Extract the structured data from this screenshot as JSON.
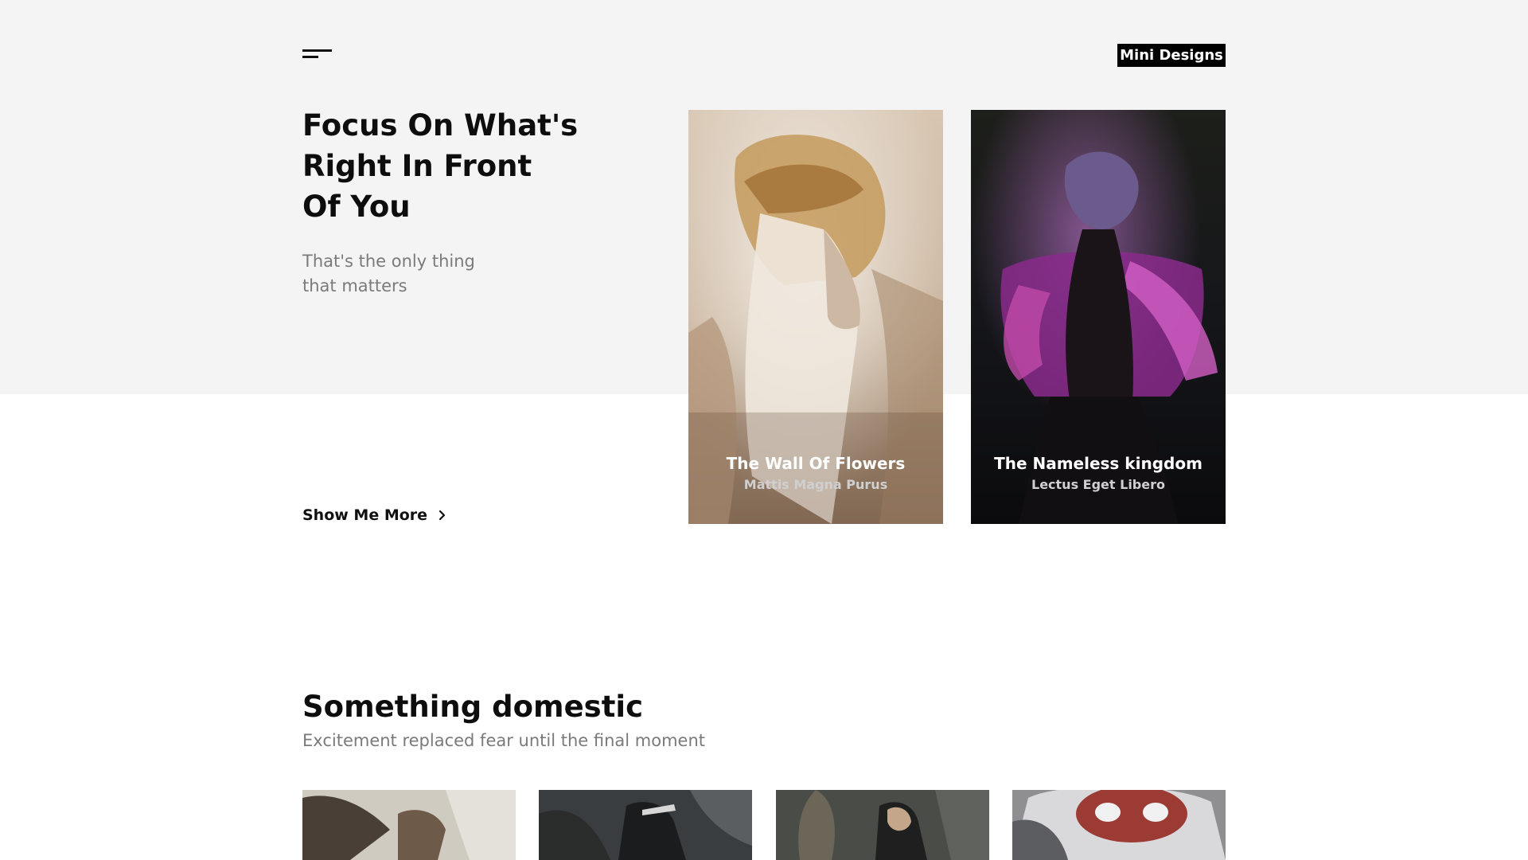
{
  "header": {
    "menu_icon": "hamburger-menu-icon",
    "brand": "Mini Designs"
  },
  "hero": {
    "title_lines": [
      "Focus On What's",
      "Right In Front",
      "Of You"
    ],
    "subtitle_lines": [
      "That's the only thing",
      "that matters"
    ],
    "show_more_label": "Show Me More",
    "show_more_icon": "chevron-right-icon"
  },
  "featured": [
    {
      "title": "The Wall Of Flowers",
      "author": "Mattis Magna Purus"
    },
    {
      "title": "The Nameless kingdom",
      "author": "Lectus Eget Libero"
    }
  ],
  "section": {
    "title": "Something domestic",
    "subtitle": "Excitement replaced fear until the final moment"
  },
  "colors": {
    "hero_background": "#f4f4f4",
    "brand_background": "#000000",
    "text_dark": "#0d0d0d",
    "text_muted": "#7a7a7a"
  }
}
